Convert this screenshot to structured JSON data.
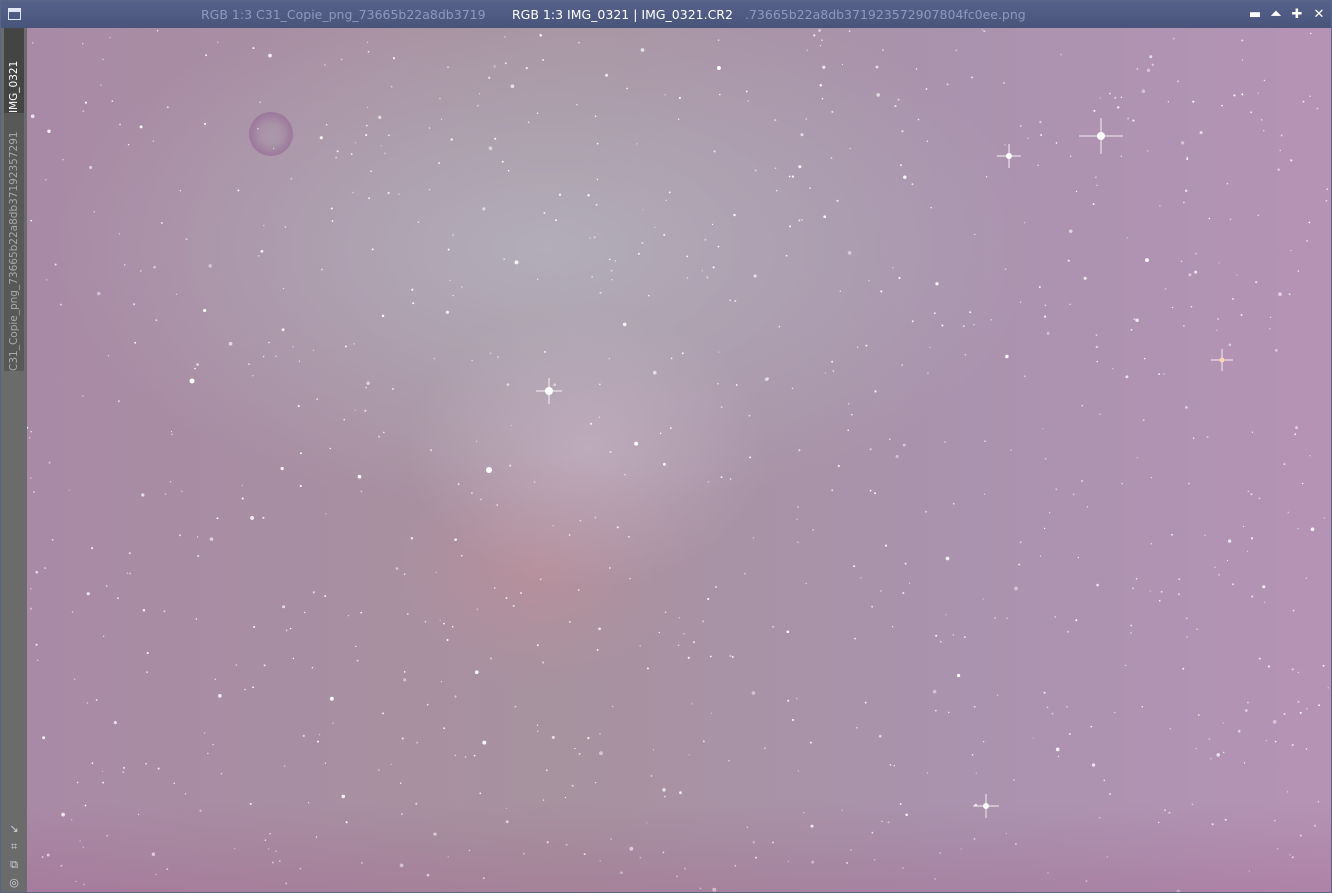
{
  "window": {
    "title_active": "RGB 1:3 IMG_0321 | IMG_0321.CR2",
    "title_ghost_left": "RGB 1:3 C31_Copie_png_73665b22a8db3719",
    "title_ghost_right": ".73665b22a8db371923572907804fc0ee.png",
    "icon": "window-icon",
    "controls": {
      "minimize": "▬",
      "shade": "⏶",
      "maximize": "✚",
      "close": "✕"
    }
  },
  "sidebar": {
    "tabs": [
      {
        "label": "IMG_0321",
        "active": true
      },
      {
        "label": "C31_Copie_png_73665b22a8db37192357291",
        "active": false
      }
    ],
    "tools": [
      "↘",
      "⌗",
      "⧉",
      "◎"
    ]
  },
  "image": {
    "description_icon": "astro-image",
    "colors": {
      "base": "#a98aa6",
      "nebula": "#cfa0a8"
    }
  }
}
